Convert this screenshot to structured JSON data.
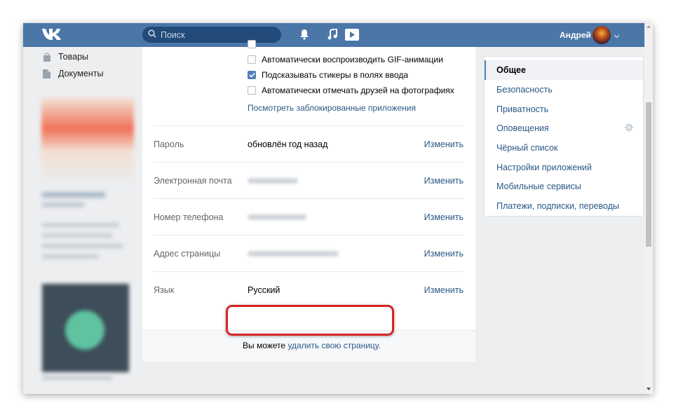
{
  "topbar": {
    "search_placeholder": "Поиск",
    "user_name": "Андрей",
    "brand_color": "#4a76a8"
  },
  "left_nav": {
    "items": [
      {
        "label": "Товары",
        "icon": "bag-icon"
      },
      {
        "label": "Документы",
        "icon": "document-icon"
      }
    ]
  },
  "settings": {
    "checkboxes": [
      {
        "label": "Автоматически воспроизводить GIF-анимации",
        "checked": false
      },
      {
        "label": "Подсказывать стикеры в полях ввода",
        "checked": true
      },
      {
        "label": "Автоматически отмечать друзей на фотографиях",
        "checked": false
      }
    ],
    "blocked_apps_link": "Посмотреть заблокированные приложения",
    "rows": [
      {
        "label": "Пароль",
        "value": "обновлён год назад",
        "action": "Изменить"
      },
      {
        "label": "Электронная почта",
        "value": "",
        "action": "Изменить"
      },
      {
        "label": "Номер телефона",
        "value": "",
        "action": "Изменить"
      },
      {
        "label": "Адрес страницы",
        "value": "",
        "action": "Изменить"
      },
      {
        "label": "Язык",
        "value": "Русский",
        "action": "Изменить"
      }
    ],
    "footer": {
      "prefix": "Вы можете",
      "delete_link": "удалить свою страницу."
    }
  },
  "right_menu": {
    "items": [
      {
        "label": "Общее",
        "active": true
      },
      {
        "label": "Безопасность",
        "active": false
      },
      {
        "label": "Приватность",
        "active": false
      },
      {
        "label": "Оповещения",
        "active": false,
        "icon": "gear-icon"
      },
      {
        "label": "Чёрный список",
        "active": false
      },
      {
        "label": "Настройки приложений",
        "active": false
      },
      {
        "label": "Мобильные сервисы",
        "active": false
      },
      {
        "label": "Платежи, подписки, переводы",
        "active": false
      }
    ]
  },
  "highlight_color": "#d82425"
}
